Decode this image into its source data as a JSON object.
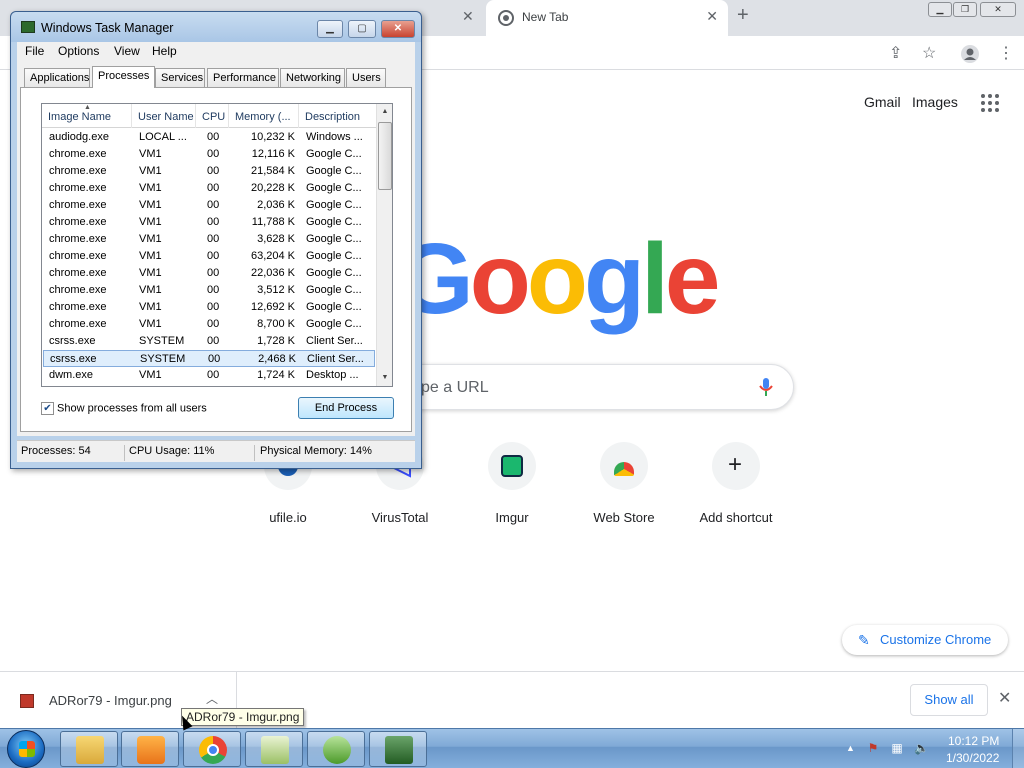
{
  "chrome": {
    "tab_title": "New Tab",
    "top_links": {
      "gmail": "Gmail",
      "images": "Images"
    },
    "search_placeholder": "Search Google or type a URL",
    "search_visible_text": "pe a URL",
    "shortcuts": [
      {
        "label": "ufile.io",
        "icon": "ufile-icon"
      },
      {
        "label": "VirusTotal",
        "icon": "virustotal-icon"
      },
      {
        "label": "Imgur",
        "icon": "imgur-icon"
      },
      {
        "label": "Web Store",
        "icon": "webstore-icon"
      },
      {
        "label": "Add shortcut",
        "icon": "plus-icon"
      }
    ],
    "customize_label": "Customize Chrome",
    "logo_colors": [
      "#4285f4",
      "#ea4335",
      "#fbbc05",
      "#4285f4",
      "#34a853",
      "#ea4335"
    ]
  },
  "download_shelf": {
    "file_name": "ADRor79 - Imgur.png",
    "show_all_label": "Show all",
    "tooltip": "ADRor79 - Imgur.png"
  },
  "task_manager": {
    "title": "Windows Task Manager",
    "menus": [
      "File",
      "Options",
      "View",
      "Help"
    ],
    "tabs": [
      "Applications",
      "Processes",
      "Services",
      "Performance",
      "Networking",
      "Users"
    ],
    "active_tab": "Processes",
    "columns": [
      "Image Name",
      "User Name",
      "CPU",
      "Memory (...",
      "Description"
    ],
    "processes": [
      {
        "name": "audiodg.exe",
        "user": "LOCAL ...",
        "cpu": "00",
        "mem": "10,232 K",
        "desc": "Windows ..."
      },
      {
        "name": "chrome.exe",
        "user": "VM1",
        "cpu": "00",
        "mem": "12,116 K",
        "desc": "Google C..."
      },
      {
        "name": "chrome.exe",
        "user": "VM1",
        "cpu": "00",
        "mem": "21,584 K",
        "desc": "Google C..."
      },
      {
        "name": "chrome.exe",
        "user": "VM1",
        "cpu": "00",
        "mem": "20,228 K",
        "desc": "Google C..."
      },
      {
        "name": "chrome.exe",
        "user": "VM1",
        "cpu": "00",
        "mem": "2,036 K",
        "desc": "Google C..."
      },
      {
        "name": "chrome.exe",
        "user": "VM1",
        "cpu": "00",
        "mem": "11,788 K",
        "desc": "Google C..."
      },
      {
        "name": "chrome.exe",
        "user": "VM1",
        "cpu": "00",
        "mem": "3,628 K",
        "desc": "Google C..."
      },
      {
        "name": "chrome.exe",
        "user": "VM1",
        "cpu": "00",
        "mem": "63,204 K",
        "desc": "Google C..."
      },
      {
        "name": "chrome.exe",
        "user": "VM1",
        "cpu": "00",
        "mem": "22,036 K",
        "desc": "Google C..."
      },
      {
        "name": "chrome.exe",
        "user": "VM1",
        "cpu": "00",
        "mem": "3,512 K",
        "desc": "Google C..."
      },
      {
        "name": "chrome.exe",
        "user": "VM1",
        "cpu": "00",
        "mem": "12,692 K",
        "desc": "Google C..."
      },
      {
        "name": "chrome.exe",
        "user": "VM1",
        "cpu": "00",
        "mem": "8,700 K",
        "desc": "Google C..."
      },
      {
        "name": "csrss.exe",
        "user": "SYSTEM",
        "cpu": "00",
        "mem": "1,728 K",
        "desc": "Client Ser..."
      },
      {
        "name": "csrss.exe",
        "user": "SYSTEM",
        "cpu": "00",
        "mem": "2,468 K",
        "desc": "Client Ser...",
        "selected": true
      },
      {
        "name": "dwm.exe",
        "user": "VM1",
        "cpu": "00",
        "mem": "1,724 K",
        "desc": "Desktop ..."
      }
    ],
    "show_all_label": "Show processes from all users",
    "show_all_checked": true,
    "end_process_label": "End Process",
    "status": {
      "processes": "Processes: 54",
      "cpu": "CPU Usage: 11%",
      "memory": "Physical Memory: 14%"
    }
  },
  "taskbar": {
    "apps": [
      "explorer-icon",
      "media-player-icon",
      "chrome-icon",
      "notepad-icon",
      "download-tool-icon",
      "task-manager-icon"
    ],
    "time": "10:12 PM",
    "date": "1/30/2022"
  }
}
